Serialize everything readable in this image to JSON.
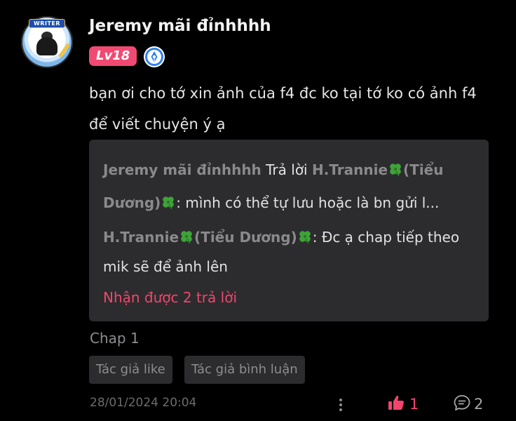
{
  "comment": {
    "author": "Jeremy mãi đỉnhhhh",
    "avatar_badge": "WRITER",
    "level": "Lv18",
    "text": "bạn ơi cho tớ xin ảnh của f4 đc ko tại tớ ko có ảnh f4 để viết chuyện ý ạ",
    "chapter": "Chap 1",
    "tags": [
      "Tác giả like",
      "Tác giả bình luận"
    ],
    "timestamp": "28/01/2024 20:04",
    "like_count": "1",
    "reply_count": "2"
  },
  "replies": [
    {
      "author": "Jeremy mãi đỉnhhhh",
      "reply_word": " Trả lời ",
      "target": "H.Trannie",
      "target_suffix": "(Tiểu Dương)",
      "text": ": mình có thể tự lưu hoặc là bn gửi l..."
    },
    {
      "author": "H.Trannie",
      "author_suffix": "(Tiểu Dương)",
      "text": ": Đc ạ chap tiếp theo mik sẽ để ảnh lên"
    }
  ],
  "more_replies_label": "Nhận được 2 trả lời",
  "colors": {
    "background": "#000000",
    "accent": "#f2456e",
    "level_badge": "#f24973",
    "reply_box": "#2c2c2e",
    "muted_text": "#8d8d8f"
  },
  "icons": {
    "writer": "writer-pen-icon",
    "clover": "four-leaf-clover-icon",
    "like": "thumbs-up-icon",
    "reply": "comment-bubble-icon",
    "more": "more-vertical-icon"
  }
}
